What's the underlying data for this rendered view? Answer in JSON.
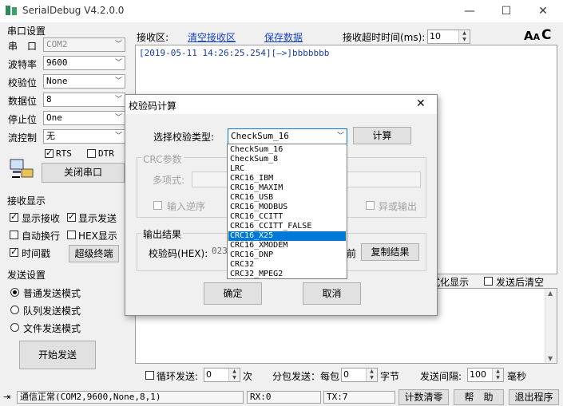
{
  "window": {
    "title": "SerialDebug V4.2.0.0",
    "minimize": "—",
    "maximize": "☐",
    "close": "✕"
  },
  "serial": {
    "section_title": "串口设置",
    "port_label": "串　口",
    "port_value": "COM2",
    "baud_label": "波特率",
    "baud_value": "9600",
    "parity_label": "校验位",
    "parity_value": "None",
    "databits_label": "数据位",
    "databits_value": "8",
    "stopbits_label": "停止位",
    "stopbits_value": "One",
    "flow_label": "流控制",
    "flow_value": "无",
    "rts_label": "RTS",
    "dtr_label": "DTR",
    "close_port_button": "关闭串口"
  },
  "receive": {
    "label": "接收区:",
    "clear_link": "清空接收区",
    "save_link": "保存数据",
    "timeout_label": "接收超时时间(ms):",
    "timeout_value": "10",
    "log_text": "[2019-05-11 14:26:25.254][—>]bbbbbbb",
    "section_title": "接收显示",
    "show_recv": "显示接收",
    "show_send": "显示发送",
    "auto_wrap": "自动换行",
    "hex_display": "HEX显示",
    "timestamp": "时间戳",
    "super_terminal": "超级终端"
  },
  "send": {
    "section_title": "发送设置",
    "normal_mode": "普通发送模式",
    "queue_mode": "队列发送模式",
    "file_mode": "文件发送模式",
    "start_button": "开始发送",
    "format_display_tail": "式化显示",
    "clear_after_send": "发送后清空",
    "loop_label": "循环发送:",
    "loop_value": "0",
    "loop_unit": "次",
    "packet_label": "分包发送：每包",
    "packet_value": "0",
    "packet_unit": "字节",
    "interval_label": "发送间隔:",
    "interval_value": "100",
    "interval_unit": "毫秒"
  },
  "status": {
    "comm": "通信正常(COM2,9600,None,8,1)",
    "rx": "RX:0",
    "tx": "TX:7",
    "clear_count": "计数清零",
    "help": "帮　助",
    "exit": "退出程序"
  },
  "dialog": {
    "title": "校验码计算",
    "type_label": "选择校验类型:",
    "type_value": "CheckSum_16",
    "compute_button": "计算",
    "crc_group": "CRC参数",
    "poly_label": "多项式:",
    "input_reverse": "输入逆序",
    "xor_output": "异或输出",
    "output_group": "输出结果",
    "checksum_label": "校验码(HEX):",
    "checksum_value": "023",
    "checksum_tail": "前",
    "copy_button": "复制结果",
    "ok_button": "确定",
    "cancel_button": "取消",
    "options": [
      "CheckSum_16",
      "CheckSum_8",
      "LRC",
      "CRC16_IBM",
      "CRC16_MAXIM",
      "CRC16_USB",
      "CRC16_MODBUS",
      "CRC16_CCITT",
      "CRC16_CCITT_FALSE",
      "CRC16_X25",
      "CRC16_XMODEM",
      "CRC16_DNP",
      "CRC32",
      "CRC32_MPEG2"
    ],
    "highlighted_index": 9
  }
}
